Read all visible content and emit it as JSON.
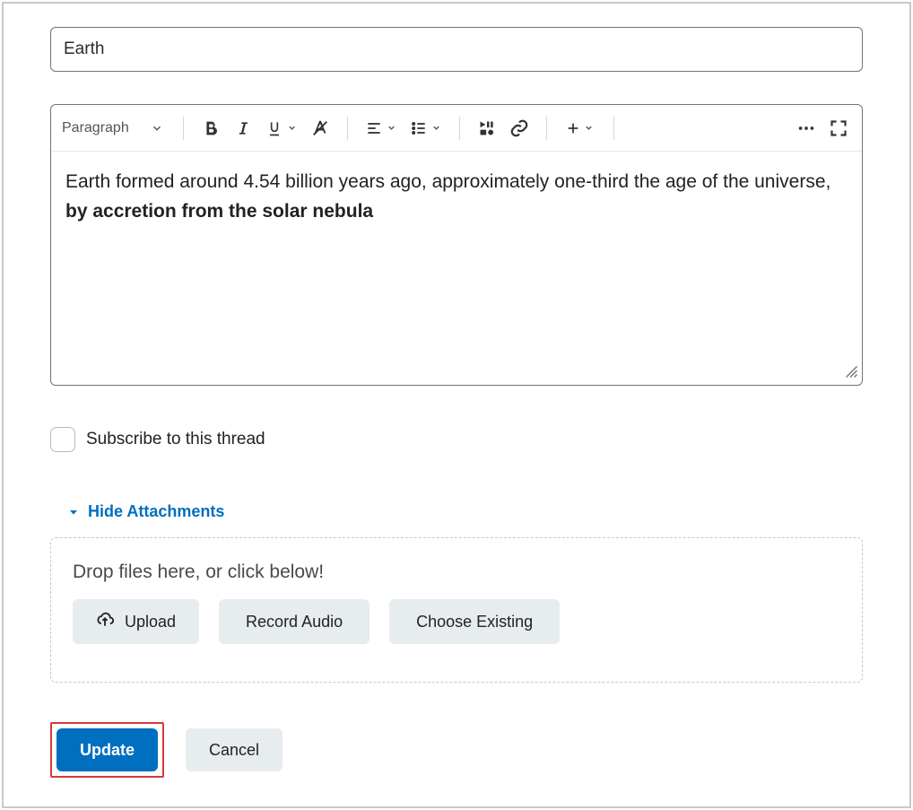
{
  "title_value": "Earth",
  "toolbar": {
    "block_style": "Paragraph"
  },
  "content": {
    "normal": "Earth formed around 4.54 billion years ago, approximately one-third the age of the universe, ",
    "bold": "by accretion from the solar nebula"
  },
  "subscribe_label": "Subscribe to this thread",
  "attachments": {
    "toggle_label": "Hide Attachments",
    "drop_text": "Drop files here, or click below!",
    "upload_label": "Upload",
    "record_label": "Record Audio",
    "choose_label": "Choose Existing"
  },
  "actions": {
    "update": "Update",
    "cancel": "Cancel"
  }
}
